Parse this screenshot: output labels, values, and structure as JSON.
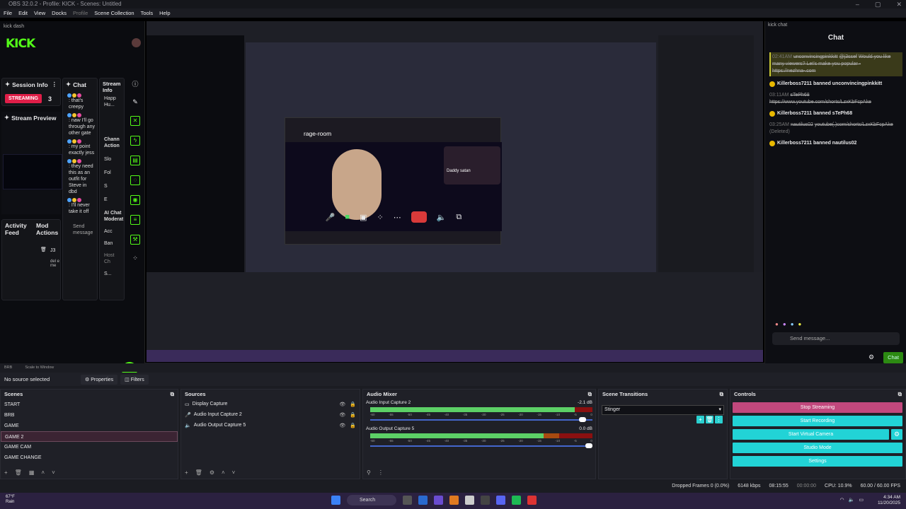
{
  "window": {
    "title": "OBS 32.0.2 - Profile: KICK - Scenes: Untitled"
  },
  "menu": [
    "File",
    "Edit",
    "View",
    "Docks",
    "Profile",
    "Scene Collection",
    "Tools",
    "Help"
  ],
  "kick_dash": {
    "dock_label": "kick dash",
    "logo": "KICK",
    "session_info": "Session Info",
    "chat_title": "Chat",
    "stream_info": "Stream Info",
    "streaming_badge": "STREAMING",
    "viewer_count": "3",
    "stream_preview": "Stream Preview",
    "chat_lines": [
      ": that's creepy",
      ": naw I'll go through any other gate",
      ": my point exactly jess",
      ": they need this as an outfit for Steve in dbd",
      ": I'll never take it off"
    ],
    "activity_feed": "Activity Feed",
    "mod_actions": "Mod Actions",
    "j3": "J3",
    "deleted_me": "del e me",
    "send": "Send message",
    "stream_info_items": [
      "Happ Hu...",
      "Chann Action",
      "Slo",
      "Fol",
      "S",
      "E",
      "AI Chat Moderat",
      "Acc",
      "Ban",
      "Host Ch",
      "S..."
    ]
  },
  "call_window": {
    "title": "rage-room",
    "overlay_text": "Daddy satan"
  },
  "kick_chat": {
    "dock_label": "kick chat",
    "title": "Chat",
    "messages": [
      {
        "time": "02:41AM",
        "user": "unconvincingpinkkitt",
        "handle": "@j3ssef",
        "text": "Would you like many viewers? Let's make you popular - https://nezhna-.com",
        "highlight": true
      },
      {
        "ban": "Killerboss7211 banned unconvincingpinkkitt"
      },
      {
        "time": "03:11AM",
        "user": "sTePh68",
        "text": "https://www.youtube.com/shorts/LzxKbFcpAke",
        "highlight": false
      },
      {
        "ban": "Killerboss7211 banned sTePh68"
      },
      {
        "time": "03:25AM",
        "user": "nautilus02",
        "text": "youtube(.)com/shorts/LzxKbFcpAke",
        "deleted": "(Deleted)"
      },
      {
        "ban": "Killerboss7211 banned nautilus02"
      }
    ],
    "input_placeholder": "Send message...",
    "chat_button": "Chat"
  },
  "obs_bottom": {
    "scene_label": "BRB",
    "scale": "Scale to Window",
    "no_source": "No source selected",
    "properties": "Properties",
    "filters": "Filters"
  },
  "scenes": {
    "title": "Scenes",
    "items": [
      "START",
      "BRB",
      "GAME",
      "GAME 2",
      "GAME CAM",
      "GAME CHANGE"
    ],
    "selected": 3
  },
  "sources": {
    "title": "Sources",
    "items": [
      "Display Capture",
      "Audio Input Capture 2",
      "Audio Output Capture 5"
    ]
  },
  "mixer": {
    "title": "Audio Mixer",
    "channels": [
      {
        "name": "Audio Input Capture 2",
        "db": "-2.1 dB",
        "level": 0.92,
        "volume": 0.97
      },
      {
        "name": "Audio Output Capture 5",
        "db": "0.0 dB",
        "level": 0.78,
        "volume": 1.0
      }
    ],
    "ticks": [
      "-60",
      "-55",
      "-50",
      "-45",
      "-40",
      "-35",
      "-30",
      "-25",
      "-20",
      "-15",
      "-10",
      "-5",
      "0"
    ]
  },
  "transitions": {
    "title": "Scene Transitions",
    "selected": "Stinger"
  },
  "controls": {
    "title": "Controls",
    "stop_streaming": "Stop Streaming",
    "start_recording": "Start Recording",
    "start_virtual_camera": "Start Virtual Camera",
    "studio_mode": "Studio Mode",
    "settings": "Settings"
  },
  "status": {
    "dropped": "Dropped Frames 0 (0.0%)",
    "bitrate": "6148 kbps",
    "time": "08:15:55",
    "rec": "00:00:00",
    "cpu": "CPU: 10.9%",
    "fps": "60.00 / 60.00 FPS"
  },
  "taskbar": {
    "temp": "67°F",
    "weather": "Rain",
    "search": "Search",
    "clock_time": "4:34 AM",
    "clock_date": "11/20/2025"
  }
}
